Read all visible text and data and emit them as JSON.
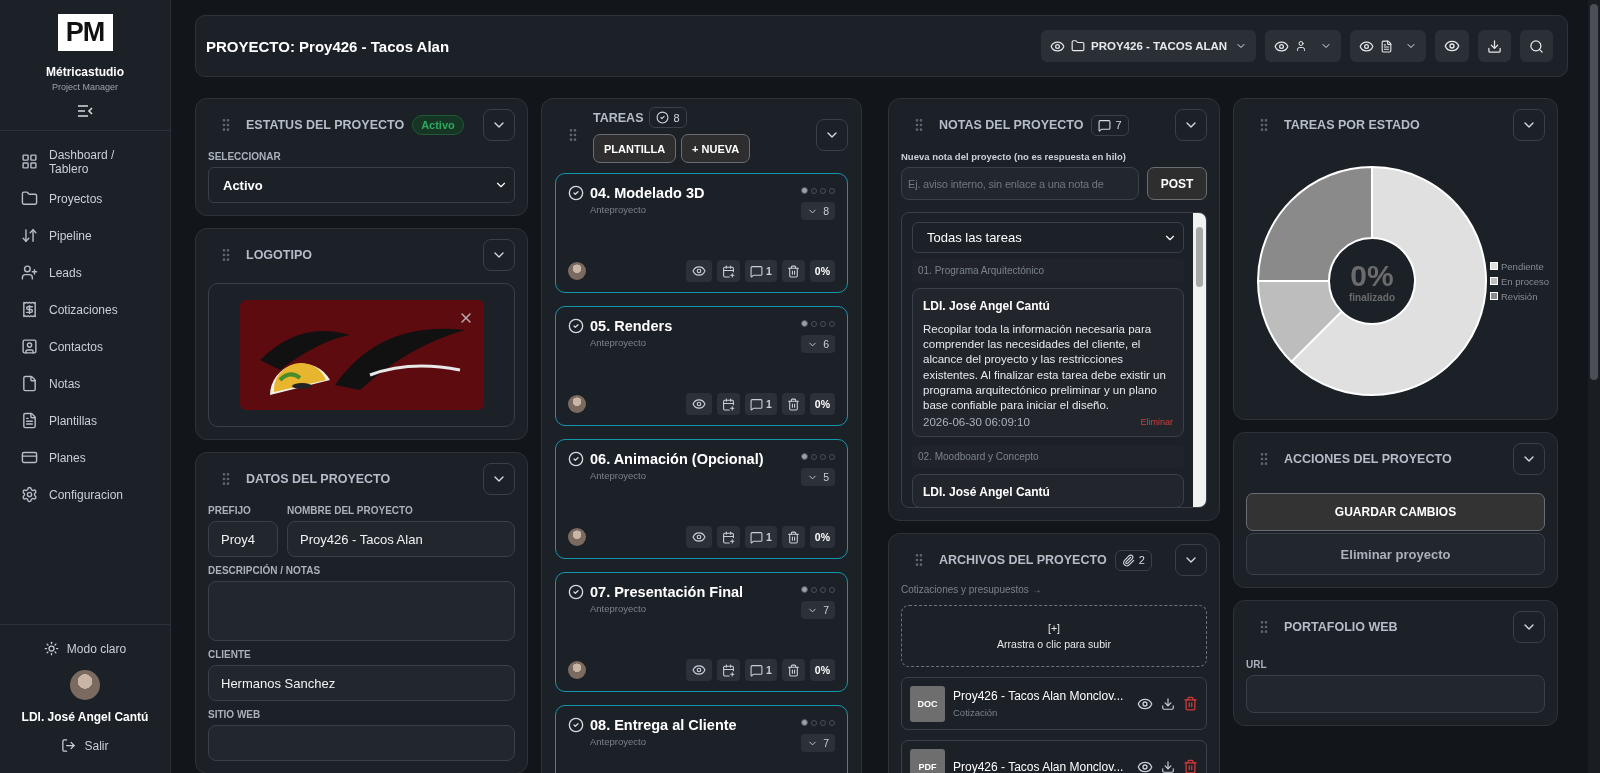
{
  "sidebar": {
    "logo": "PM",
    "brand": "Métricastudio",
    "subtitle": "Project Manager",
    "items": [
      {
        "label": "Dashboard / Tablero",
        "selected": false
      },
      {
        "label": "Proyectos",
        "selected": false
      },
      {
        "label": "Pipeline",
        "selected": false
      },
      {
        "label": "Leads",
        "selected": false
      },
      {
        "label": "Cotizaciones",
        "selected": false
      },
      {
        "label": "Contactos",
        "selected": false
      },
      {
        "label": "Notas",
        "selected": false
      },
      {
        "label": "Plantillas",
        "selected": false
      },
      {
        "label": "Planes",
        "selected": false
      },
      {
        "label": "Configuracion",
        "selected": false
      }
    ],
    "theme_toggle": "Modo claro",
    "user": "LDI. José Angel Cantú",
    "logout": "Salir"
  },
  "header": {
    "title": "PROYECTO: Proy426 - Tacos Alan",
    "project_menu": "PROY426 - TACOS ALAN"
  },
  "status_card": {
    "title": "ESTATUS DEL PROYECTO",
    "badge": "Activo",
    "field_label": "SELECCIONAR",
    "value": "Activo"
  },
  "logo_card": {
    "title": "LOGOTIPO"
  },
  "project_data": {
    "title": "DATOS DEL PROYECTO",
    "rows": [
      [
        {
          "label": "PREFIJO",
          "value": "Proy4",
          "kind": "short"
        },
        {
          "label": "NOMBRE DEL PROYECTO",
          "value": "Proy426 - Tacos Alan",
          "kind": "input"
        }
      ],
      [
        {
          "label": "DESCRIPCIÓN / NOTAS",
          "kind": "textarea"
        }
      ],
      [
        {
          "label": "CLIENTE",
          "value": "Hermanos Sanchez",
          "kind": "input"
        }
      ],
      [
        {
          "label": "SITIO WEB",
          "kind": "input"
        }
      ]
    ]
  },
  "tasks": {
    "title": "TAREAS",
    "count": "8",
    "buttons": [
      "PLANTILLA",
      "+ NUEVA"
    ],
    "items": [
      {
        "title": "04. Modelado 3D",
        "phase": "Anteproyecto",
        "steps": [
          {
            "done": true
          },
          {
            "done": false
          },
          {
            "done": false
          },
          {
            "done": false
          }
        ],
        "subtasks": "8",
        "comments": "1",
        "progress": "0%"
      },
      {
        "title": "05. Renders",
        "phase": "Anteproyecto",
        "steps": [
          {
            "done": true
          },
          {
            "done": false
          },
          {
            "done": false
          },
          {
            "done": false
          }
        ],
        "subtasks": "6",
        "comments": "1",
        "progress": "0%"
      },
      {
        "title": "06. Animación (Opcional)",
        "phase": "Anteproyecto",
        "steps": [
          {
            "done": true
          },
          {
            "done": false
          },
          {
            "done": false
          },
          {
            "done": false
          }
        ],
        "subtasks": "5",
        "comments": "1",
        "progress": "0%"
      },
      {
        "title": "07. Presentación Final",
        "phase": "Anteproyecto",
        "steps": [
          {
            "done": true
          },
          {
            "done": false
          },
          {
            "done": false
          },
          {
            "done": false
          }
        ],
        "subtasks": "7",
        "comments": "1",
        "progress": "0%"
      },
      {
        "title": "08. Entrega al Cliente",
        "phase": "Anteproyecto",
        "steps": [
          {
            "done": true
          },
          {
            "done": false
          },
          {
            "done": false
          },
          {
            "done": false
          }
        ],
        "subtasks": "7"
      }
    ]
  },
  "notes": {
    "title": "NOTAS DEL PROYECTO",
    "count": "7",
    "input_label": "Nueva nota del proyecto (no es respuesta en hilo)",
    "placeholder": "Ej. aviso interno, sin enlace a una nota de",
    "post": "POST",
    "filter": "Todas las tareas",
    "groups": [
      {
        "task": "01. Programa Arquitectónico",
        "notes": [
          {
            "author": "LDI. José Angel Cantú",
            "text": "Recopilar toda la información necesaria para comprender las necesidades del cliente, el alcance del proyecto y las restricciones existentes. Al finalizar esta tarea debe existir un programa arquitectónico preliminar y un plano base confiable para iniciar el diseño.",
            "date": "2026-06-30 06:09:10",
            "delete": "Eliminar"
          }
        ]
      },
      {
        "task": "02. Moodboard y Concepto",
        "notes": [
          {
            "author": "LDI. José Angel Cantú"
          }
        ]
      }
    ]
  },
  "files": {
    "title": "ARCHIVOS DEL PROYECTO",
    "count": "2",
    "link": "Cotizaciones y presupuestos →",
    "dropzone_mark": "[+]",
    "dropzone_text": "Arrastra o clic para subir",
    "items": [
      {
        "type": "DOC",
        "name": "Proy426 - Tacos Alan Monclov...",
        "category": "Cotización"
      },
      {
        "type": "PDF",
        "name": "Proy426 - Tacos Alan Monclov..."
      }
    ]
  },
  "chart_card": {
    "title": "TAREAS POR ESTADO",
    "center_value": "0%",
    "center_label": "finalizado",
    "chart_data": {
      "type": "donut",
      "categories": [
        "Pendiente",
        "En proceso",
        "Revisión"
      ],
      "values": [
        62.5,
        12.5,
        25
      ]
    }
  },
  "actions": {
    "title": "ACCIONES DEL PROYECTO",
    "save": "GUARDAR CAMBIOS",
    "delete": "Eliminar proyecto"
  },
  "portfolio": {
    "title": "PORTAFOLIO WEB",
    "field_label": "URL"
  }
}
